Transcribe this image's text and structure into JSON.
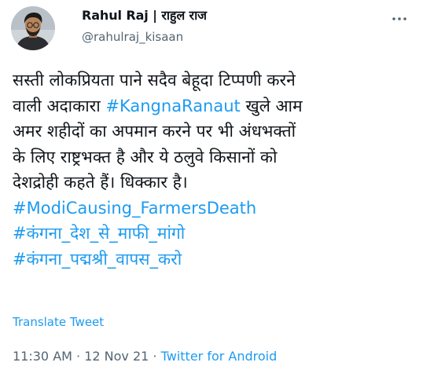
{
  "user": {
    "display_name": "Rahul Raj | राहुल राज",
    "handle": "@rahulraj_kisaan"
  },
  "icons": {
    "avatar": "user-avatar",
    "more": "more-options-icon"
  },
  "tweet": {
    "lines": [
      {
        "text": "सस्ती लोकप्रियता पाने सदैव बेहूदा टिप्पणी करने"
      },
      {
        "prefix": "वाली अदाकारा ",
        "hashtag": "#KangnaRanaut",
        "suffix": " खुले आम"
      },
      {
        "text": "अमर शहीदों का अपमान करने पर भी अंधभक्तों"
      },
      {
        "text": "के लिए राष्ट्रभक्त है और ये ठलुवे किसानों को"
      },
      {
        "text": "देशद्रोही कहते हैं। धिक्कार है।"
      },
      {
        "hashtag": "#ModiCausing_FarmersDeath"
      },
      {
        "hashtag": "#कंगना_देश_से_माफी_मांगो"
      },
      {
        "hashtag": "#कंगना_पद्मश्री_वापस_करो"
      }
    ],
    "translate_label": "Translate Tweet",
    "time": "11:30 AM",
    "separator": " · ",
    "date": "12 Nov 21",
    "source": "Twitter for Android"
  },
  "colors": {
    "link": "#1d9bf0",
    "text": "#0f1419",
    "muted": "#536471"
  }
}
